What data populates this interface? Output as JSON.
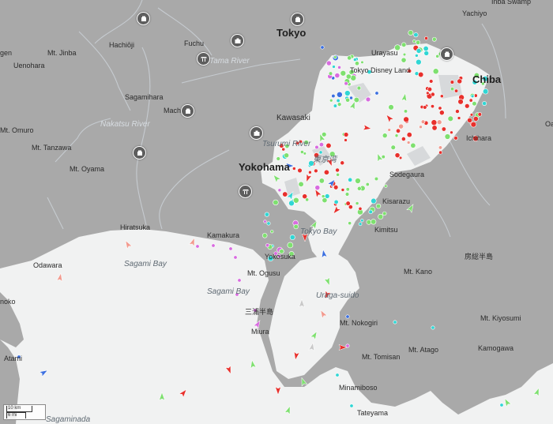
{
  "map": {
    "labels": [
      {
        "id": "yachiyo",
        "text": "Yachiyo",
        "cls": ""
      },
      {
        "id": "inba-swamp",
        "text": "Inba Swamp",
        "cls": ""
      },
      {
        "id": "hachioji",
        "text": "Hachiōji",
        "cls": ""
      },
      {
        "id": "fuchu",
        "text": "Fuchu",
        "cls": ""
      },
      {
        "id": "tokyo",
        "text": "Tokyo",
        "cls": "city"
      },
      {
        "id": "mt-jinba",
        "text": "Mt. Jinba",
        "cls": ""
      },
      {
        "id": "gen",
        "text": "gen",
        "cls": ""
      },
      {
        "id": "uenohara",
        "text": "Uenohara",
        "cls": ""
      },
      {
        "id": "tama-river",
        "text": "Tama River",
        "cls": "river"
      },
      {
        "id": "urayasu",
        "text": "Urayasu",
        "cls": ""
      },
      {
        "id": "tokyo-disney-land",
        "text": "Tokyo Disney Land",
        "cls": ""
      },
      {
        "id": "chiba",
        "text": "Chiba",
        "cls": "city"
      },
      {
        "id": "sagamihara",
        "text": "Sagamihara",
        "cls": ""
      },
      {
        "id": "machida",
        "text": "Machida",
        "cls": ""
      },
      {
        "id": "nakatsu-river",
        "text": "Nakatsu River",
        "cls": "river"
      },
      {
        "id": "kawasaki",
        "text": "Kawasaki",
        "cls": "medium"
      },
      {
        "id": "mt-omuro",
        "text": "Mt. Omuro",
        "cls": ""
      },
      {
        "id": "mt-tanzawa",
        "text": "Mt. Tanzawa",
        "cls": ""
      },
      {
        "id": "tsurumi-river",
        "text": "Tsurumi River",
        "cls": "water"
      },
      {
        "id": "ichihara",
        "text": "Ichihara",
        "cls": ""
      },
      {
        "id": "oa",
        "text": "Oa",
        "cls": ""
      },
      {
        "id": "mt-oyama",
        "text": "Mt. Oyama",
        "cls": ""
      },
      {
        "id": "yokohama",
        "text": "Yokohama",
        "cls": "city"
      },
      {
        "id": "tokyo-bay-jp",
        "text": "東京湾",
        "cls": "water"
      },
      {
        "id": "sodegaura",
        "text": "Sodegaura",
        "cls": ""
      },
      {
        "id": "kisarazu",
        "text": "Kisarazu",
        "cls": ""
      },
      {
        "id": "hiratsuka",
        "text": "Hiratsuka",
        "cls": ""
      },
      {
        "id": "kamakura",
        "text": "Kamakura",
        "cls": ""
      },
      {
        "id": "tokyo-bay",
        "text": "Tokyo Bay",
        "cls": "water"
      },
      {
        "id": "kimitsu",
        "text": "Kimitsu",
        "cls": ""
      },
      {
        "id": "sagami-bay",
        "text": "Sagami Bay",
        "cls": "water"
      },
      {
        "id": "odawara",
        "text": "Odawara",
        "cls": ""
      },
      {
        "id": "yokosuka",
        "text": "Yokosuka",
        "cls": ""
      },
      {
        "id": "boso-peninsula",
        "text": "房総半島",
        "cls": ""
      },
      {
        "id": "mt-ogusu",
        "text": "Mt. Ogusu",
        "cls": ""
      },
      {
        "id": "mt-kano",
        "text": "Mt. Kano",
        "cls": ""
      },
      {
        "id": "sagami-bay-2",
        "text": "Sagami Bay",
        "cls": "water"
      },
      {
        "id": "uraga-suido",
        "text": "Uraga-suido",
        "cls": "water"
      },
      {
        "id": "noko",
        "text": "noko",
        "cls": ""
      },
      {
        "id": "miura-peninsula",
        "text": "三浦半島",
        "cls": ""
      },
      {
        "id": "mt-nokogiri",
        "text": "Mt. Nokogiri",
        "cls": ""
      },
      {
        "id": "mt-kiyosumi",
        "text": "Mt. Kiyosumi",
        "cls": ""
      },
      {
        "id": "miura",
        "text": "Miura",
        "cls": ""
      },
      {
        "id": "mt-atago",
        "text": "Mt. Atago",
        "cls": ""
      },
      {
        "id": "kamogawa",
        "text": "Kamogawa",
        "cls": ""
      },
      {
        "id": "mt-tomisan",
        "text": "Mt. Tomisan",
        "cls": ""
      },
      {
        "id": "atami",
        "text": "Atami",
        "cls": ""
      },
      {
        "id": "minamiboso",
        "text": "Minamiboso",
        "cls": ""
      },
      {
        "id": "tateyama",
        "text": "Tateyama",
        "cls": ""
      },
      {
        "id": "sagaminada",
        "text": "Sagaminada",
        "cls": "water"
      }
    ],
    "poi_markers": [
      {
        "id": "hachioji-poi",
        "icon": "castle"
      },
      {
        "id": "tokyo-poi",
        "icon": "castle"
      },
      {
        "id": "fuchu-poi",
        "icon": "museum"
      },
      {
        "id": "uenohara-poi",
        "icon": "temple"
      },
      {
        "id": "chiba-poi",
        "icon": "castle"
      },
      {
        "id": "machida-poi",
        "icon": "castle"
      },
      {
        "id": "kawasaki-poi",
        "icon": "museum"
      },
      {
        "id": "oyama-poi",
        "icon": "castle"
      },
      {
        "id": "yokohama-poi",
        "icon": "temple"
      }
    ],
    "scale": {
      "primary": "10 km",
      "secondary": "6 mi"
    },
    "colors": {
      "land": "#a9a9a9",
      "water": "#f1f2f2",
      "cargo": "#7ee06f",
      "tanker": "#e8302c",
      "passenger": "#3b6fe0",
      "tug": "#30d6d4",
      "pleasure": "#d86be0",
      "unknown": "#c9c9c9",
      "fishing": "#f29a8e"
    }
  }
}
